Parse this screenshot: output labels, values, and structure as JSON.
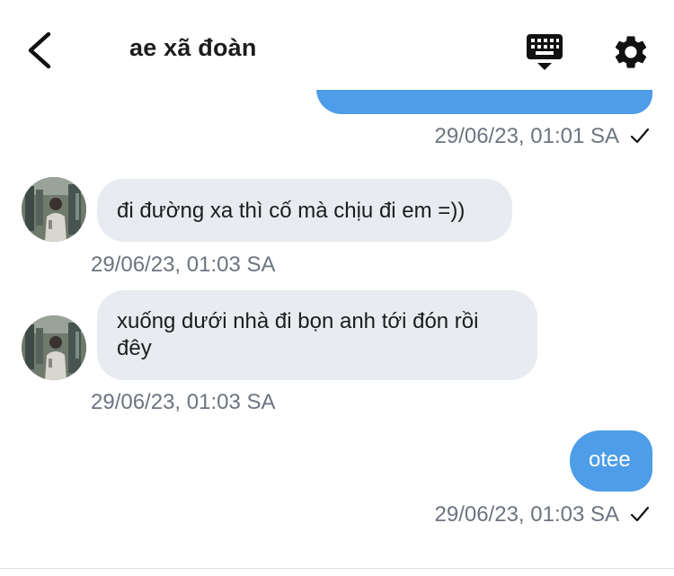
{
  "header": {
    "title": "ae xã đoàn"
  },
  "icons": {
    "back": "chevron-left-icon",
    "keyboard": "keyboard-icon",
    "settings": "gear-icon",
    "read_receipt": "check-icon"
  },
  "colors": {
    "outgoing_bubble": "#4d9de8",
    "incoming_bubble": "#e8ebef",
    "timestamp": "#6d7480"
  },
  "messages": [
    {
      "direction": "outgoing",
      "text": "",
      "timestamp": "29/06/23, 01:01 SA",
      "read": true
    },
    {
      "direction": "incoming",
      "text": "đi đường xa thì cố mà chịu đi em =))",
      "timestamp": "29/06/23, 01:03 SA"
    },
    {
      "direction": "incoming",
      "text": "xuống dưới nhà đi bọn anh tới đón rồi đêy",
      "timestamp": "29/06/23, 01:03 SA"
    },
    {
      "direction": "outgoing",
      "text": "otee",
      "timestamp": "29/06/23, 01:03 SA",
      "read": true
    }
  ]
}
